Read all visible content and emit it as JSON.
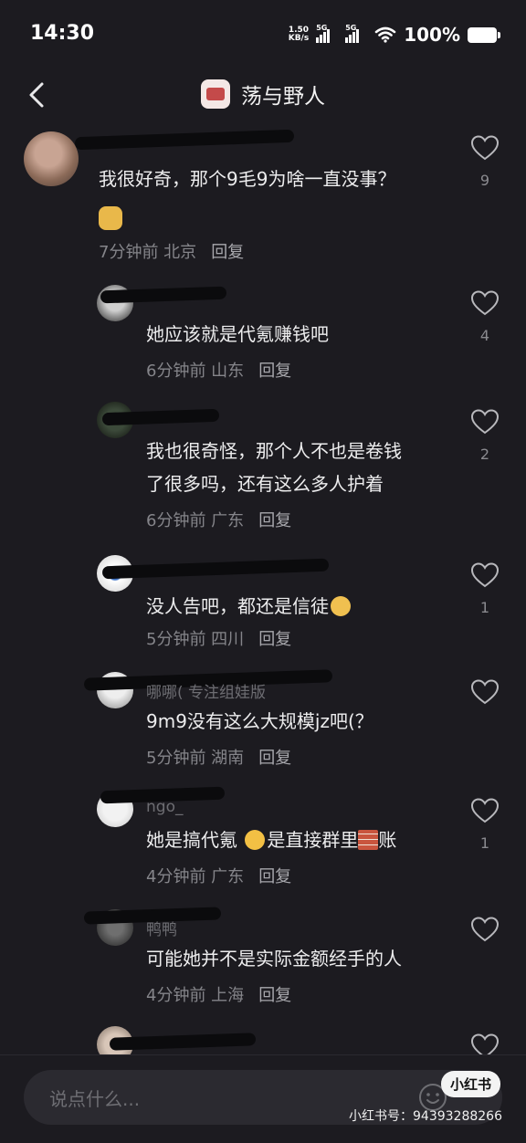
{
  "status": {
    "time": "14:30",
    "speed_value": "1.50",
    "speed_unit": "KB/s",
    "net1": "5G",
    "net2": "5G",
    "battery": "100%"
  },
  "header": {
    "title": "荡与野人"
  },
  "comments": [
    {
      "text": "我很好奇，那个9毛9为啥一直没事？",
      "meta": "7分钟前 北京",
      "reply": "回复",
      "likes": "9"
    },
    {
      "text": "她应该就是代氪赚钱吧",
      "meta": "6分钟前 山东",
      "reply": "回复",
      "likes": "4"
    },
    {
      "text1": "我也很奇怪，那个人不也是卷钱",
      "text2": "了很多吗，还有这么多人护着",
      "meta": "6分钟前 广东",
      "reply": "回复",
      "likes": "2"
    },
    {
      "text": "没人告吧，都还是信徒",
      "meta": "5分钟前 四川",
      "reply": "回复",
      "likes": "1"
    },
    {
      "name": "哪哪( 专注组娃版",
      "text": "9m9没有这么大规模jz吧(？",
      "meta": "5分钟前 湖南",
      "reply": "回复",
      "likes": ""
    },
    {
      "name": "ngo_",
      "text_a": "她是搞代氪",
      "text_b": "是直接群里",
      "text_c": "账",
      "meta": "4分钟前 广东",
      "reply": "回复",
      "likes": "1"
    },
    {
      "name": "鸭鸭",
      "text": "可能她并不是实际金额经手的人",
      "meta": "4分钟前 上海",
      "reply": "回复",
      "likes": ""
    }
  ],
  "input": {
    "placeholder": "说点什么..."
  },
  "watermark": {
    "tag": "小红书",
    "id": "小红书号：94393288266"
  },
  "colors": {
    "background": "#1c1b20",
    "text": "#ededee",
    "meta": "#85858a"
  }
}
